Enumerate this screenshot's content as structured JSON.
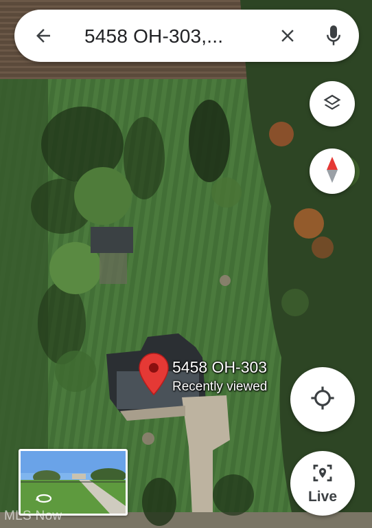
{
  "search": {
    "query": "5458 OH-303,...",
    "back_icon": "arrow-back-icon",
    "clear_icon": "close-icon",
    "mic_icon": "mic-icon"
  },
  "controls": {
    "layers_icon": "layers-icon",
    "compass_icon": "compass-icon",
    "location_icon": "my-location-icon",
    "live_label": "Live"
  },
  "place": {
    "title": "5458 OH-303",
    "subtitle": "Recently viewed",
    "pin_color": "#e53935"
  },
  "street_view": {
    "icon": "360-rotate-icon"
  },
  "watermark": "MLS Now",
  "colors": {
    "grass": "#3f6b34",
    "field": "#5a4a3a",
    "trees": "#2f4a25",
    "accent_red": "#e53935"
  }
}
